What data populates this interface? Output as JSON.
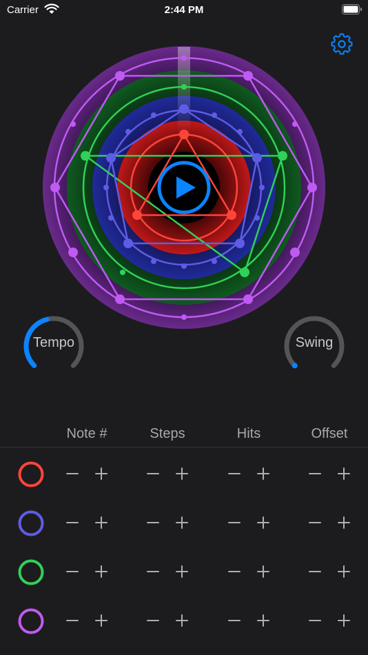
{
  "status_bar": {
    "carrier": "Carrier",
    "time": "2:44 PM"
  },
  "icons": {
    "wifi": "wifi-icon",
    "battery": "battery-icon",
    "settings": "gear-icon",
    "play": "play-icon",
    "minus": "minus-icon",
    "plus": "plus-icon"
  },
  "colors": {
    "background": "#1c1c1e",
    "accent": "#0a84ff",
    "red": "#ff453a",
    "blue": "#5e5ce6",
    "green": "#30d158",
    "purple": "#bf5af2"
  },
  "knobs": {
    "tempo": {
      "label": "Tempo",
      "level": 0.35
    },
    "swing": {
      "label": "Swing",
      "level": 0.0
    }
  },
  "table": {
    "headers": [
      "Note #",
      "Steps",
      "Hits",
      "Offset"
    ]
  },
  "tracks": [
    {
      "name": "red"
    },
    {
      "name": "blue"
    },
    {
      "name": "green"
    },
    {
      "name": "purple"
    }
  ]
}
